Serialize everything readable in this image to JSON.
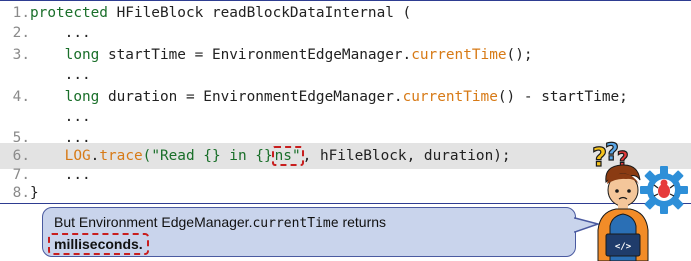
{
  "code": {
    "lines": [
      {
        "num": "1.",
        "text": "protected HFileBlock readBlockDataInternal ("
      },
      {
        "num": "2.",
        "text": "..."
      },
      {
        "num": "3.",
        "kw": "long",
        "pre": " startTime = EnvironmentEdgeManager.",
        "fn": "currentTime",
        "post": "();",
        "cont": "..."
      },
      {
        "num": "4.",
        "kw": "long",
        "pre": " duration = EnvironmentEdgeManager.",
        "fn": "currentTime",
        "post": "() - startTime;",
        "cont": "..."
      },
      {
        "num": "5.",
        "text": "..."
      },
      {
        "num": "6.",
        "obj": "LOG",
        "dot": ".",
        "fn": "trace",
        "str_open": "(\"Read {} in {}",
        "boxed": "ns\"",
        "rest": ", hFileBlock, duration);"
      },
      {
        "num": "7.",
        "text": "..."
      },
      {
        "num": "8.",
        "text": "}"
      }
    ]
  },
  "callout": {
    "prefix": "But Environment EdgeManager.",
    "mono": "currentTime",
    "suffix": " returns",
    "emphasis": "milliseconds."
  },
  "icons": {
    "question": "question-marks-icon",
    "gear": "gear-bug-icon",
    "developer": "developer-avatar-icon",
    "code": "code-brackets-icon"
  },
  "colors": {
    "keyword": "#1a6f2a",
    "function": "#d77a16",
    "highlight": "#e3e3e3",
    "warning": "#c81e1e",
    "callout_bg": "#c9d4ec",
    "rule": "#2e3d91"
  }
}
